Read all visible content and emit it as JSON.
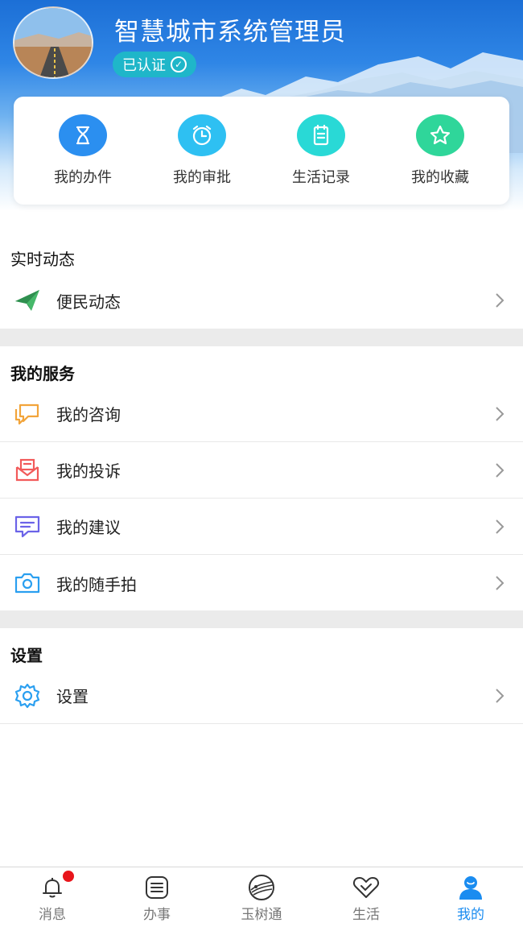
{
  "profile": {
    "name": "智慧城市系统管理员",
    "verified_label": "已认证"
  },
  "quick_actions": [
    {
      "label": "我的办件",
      "icon": "hourglass-icon",
      "color": "#2b8ff0"
    },
    {
      "label": "我的审批",
      "icon": "alarm-clock-icon",
      "color": "#2ec0f2"
    },
    {
      "label": "生活记录",
      "icon": "notepad-icon",
      "color": "#29d9d6"
    },
    {
      "label": "我的收藏",
      "icon": "star-icon",
      "color": "#2fd69a"
    }
  ],
  "sections": {
    "realtime": {
      "title": "实时动态",
      "items": [
        {
          "label": "便民动态",
          "icon": "paper-plane-icon"
        }
      ]
    },
    "services": {
      "title": "我的服务",
      "items": [
        {
          "label": "我的咨询",
          "icon": "chat-bubbles-icon",
          "color": "#f2a43a"
        },
        {
          "label": "我的投诉",
          "icon": "mail-tray-icon",
          "color": "#f25a5a"
        },
        {
          "label": "我的建议",
          "icon": "message-icon",
          "color": "#6b63e8"
        },
        {
          "label": "我的随手拍",
          "icon": "camera-icon",
          "color": "#2a9ff0"
        }
      ]
    },
    "settings": {
      "title": "设置",
      "items": [
        {
          "label": "设置",
          "icon": "gear-icon",
          "color": "#2a9ff0"
        }
      ]
    }
  },
  "tabbar": {
    "active_color": "#1a8cf0",
    "items": [
      {
        "label": "消息",
        "icon": "bell-icon",
        "badge": true
      },
      {
        "label": "办事",
        "icon": "list-icon"
      },
      {
        "label": "玉树通",
        "icon": "logo-icon"
      },
      {
        "label": "生活",
        "icon": "heart-icon"
      },
      {
        "label": "我的",
        "icon": "user-icon",
        "active": true
      }
    ]
  }
}
